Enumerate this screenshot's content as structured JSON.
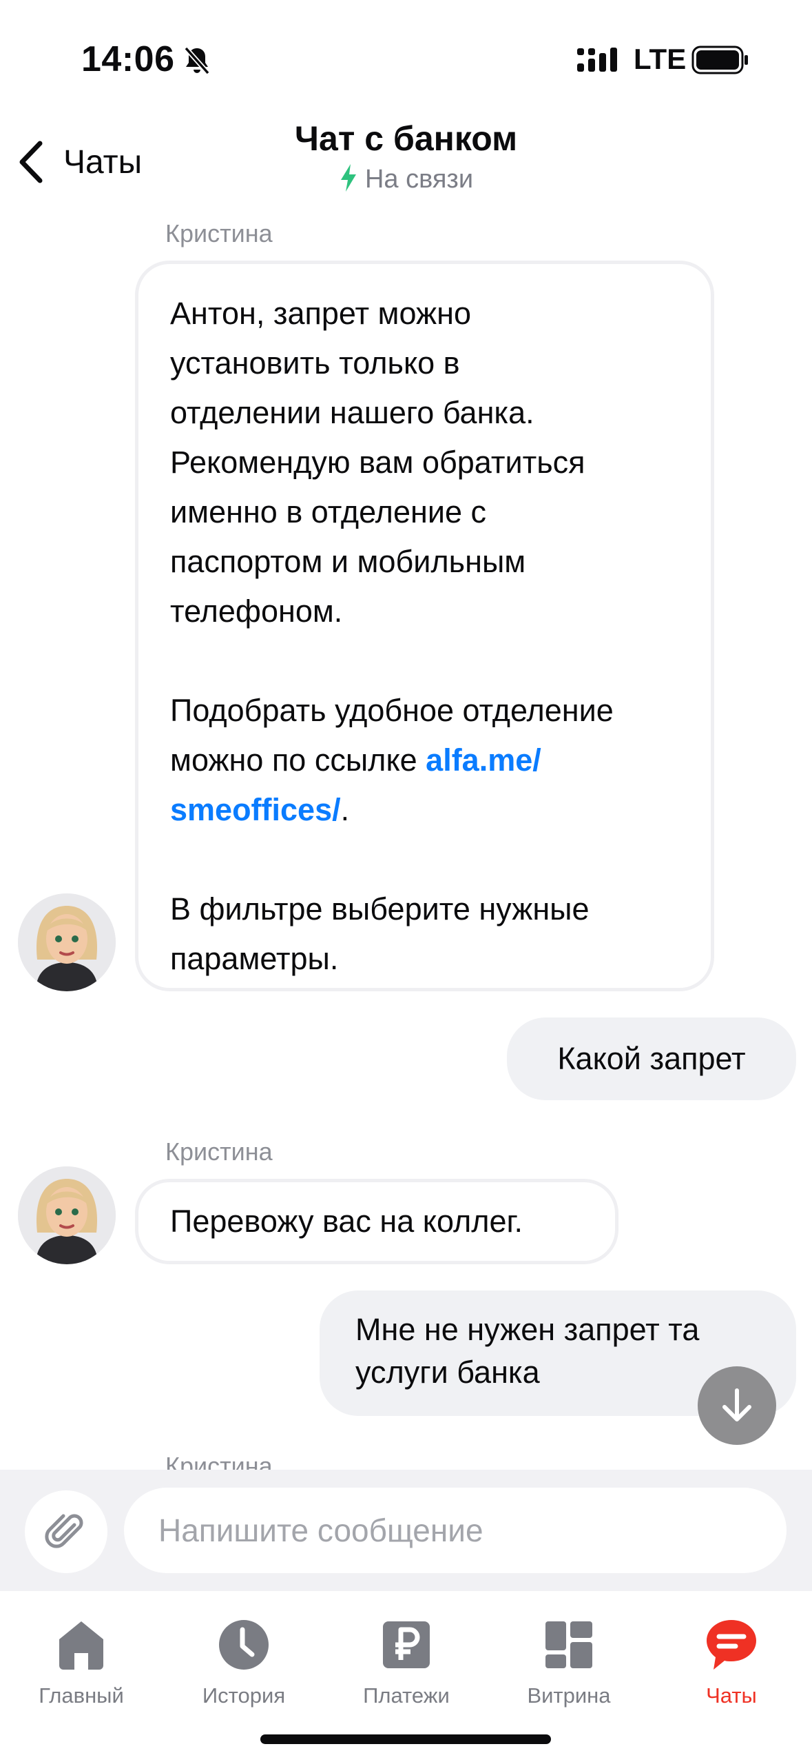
{
  "status_bar": {
    "time": "14:06",
    "network": "LTE",
    "icons": [
      "bell-slash-icon",
      "signal-icon",
      "battery-icon"
    ]
  },
  "header": {
    "back_label": "Чаты",
    "title": "Чат с банком",
    "status": "На связи",
    "status_color": "#2ec27e"
  },
  "messages": [
    {
      "direction": "incoming",
      "sender": "Кристина",
      "lines": [
        "Антон, запрет можно",
        "установить только в",
        "отделении нашего банка.",
        "Рекомендую вам обратиться",
        "именно в отделение с",
        "паспортом и мобильным",
        "телефоном.",
        "",
        "Подобрать удобное отделение",
        "можно по ссылке ",
        "",
        "",
        "В фильтре выберите нужные",
        "параметры."
      ],
      "link_part1": "alfa.me/",
      "link_part2": "smeoffices/",
      "link_suffix": "."
    },
    {
      "direction": "outgoing",
      "text": "Какой запрет"
    },
    {
      "direction": "incoming",
      "sender": "Кристина",
      "text": "Перевожу вас на коллег."
    },
    {
      "direction": "outgoing",
      "lines": [
        "Мне не нужен запрет та",
        "услуги банка"
      ]
    },
    {
      "direction": "incoming",
      "sender": "Кристина"
    }
  ],
  "composer": {
    "placeholder": "Напишите сообщение",
    "value": ""
  },
  "tabs": [
    {
      "label": "Главный",
      "icon": "home-icon",
      "active": false
    },
    {
      "label": "История",
      "icon": "clock-icon",
      "active": false
    },
    {
      "label": "Платежи",
      "icon": "ruble-icon",
      "active": false
    },
    {
      "label": "Витрина",
      "icon": "showcase-grid-icon",
      "active": false
    },
    {
      "label": "Чаты",
      "icon": "chat-bubble-icon",
      "active": true
    }
  ],
  "colors": {
    "accent": "#ef3124",
    "link": "#0a7cff",
    "bubble_out": "#f0f1f4",
    "inactive_icon": "#7a7c83"
  }
}
